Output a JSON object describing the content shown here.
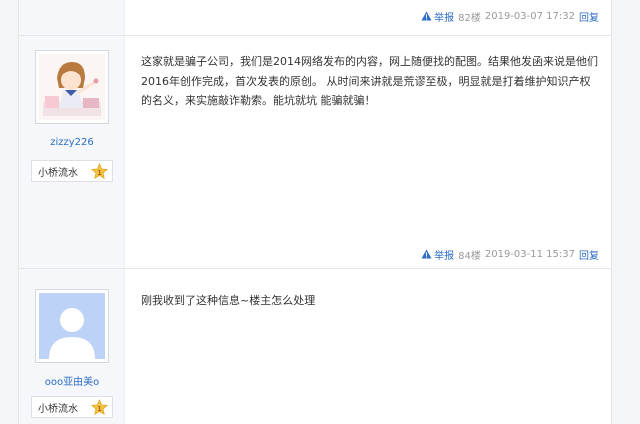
{
  "posts": [
    {
      "floor": "82楼",
      "date": "2019-03-07 17:32",
      "report_label": "举报",
      "reply_label": "回复"
    },
    {
      "username": "zizzy226",
      "rank": "小桥流水",
      "rank_level": "1",
      "content": "这家就是骗子公司，我们是2014网络发布的内容，网上随便找的配图。结果他发函来说是他们2016年创作完成，首次发表的原创。 从时间来讲就是荒谬至极，明显就是打着维护知识产权的名义，来实施敲诈勒索。能坑就坑 能骗就骗！",
      "floor": "84楼",
      "date": "2019-03-11 15:37",
      "report_label": "举报",
      "reply_label": "回复"
    },
    {
      "username": "ooo亚由美o",
      "rank": "小桥流水",
      "rank_level": "1",
      "content": "刚我收到了这种信息~楼主怎么处理"
    }
  ],
  "colors": {
    "link": "#2b6cc4",
    "meta": "#999999",
    "sidebar_bg": "#f5f7fb",
    "star": "#f4c542"
  },
  "icons": {
    "report": "warning-icon",
    "rank": "star-icon"
  }
}
